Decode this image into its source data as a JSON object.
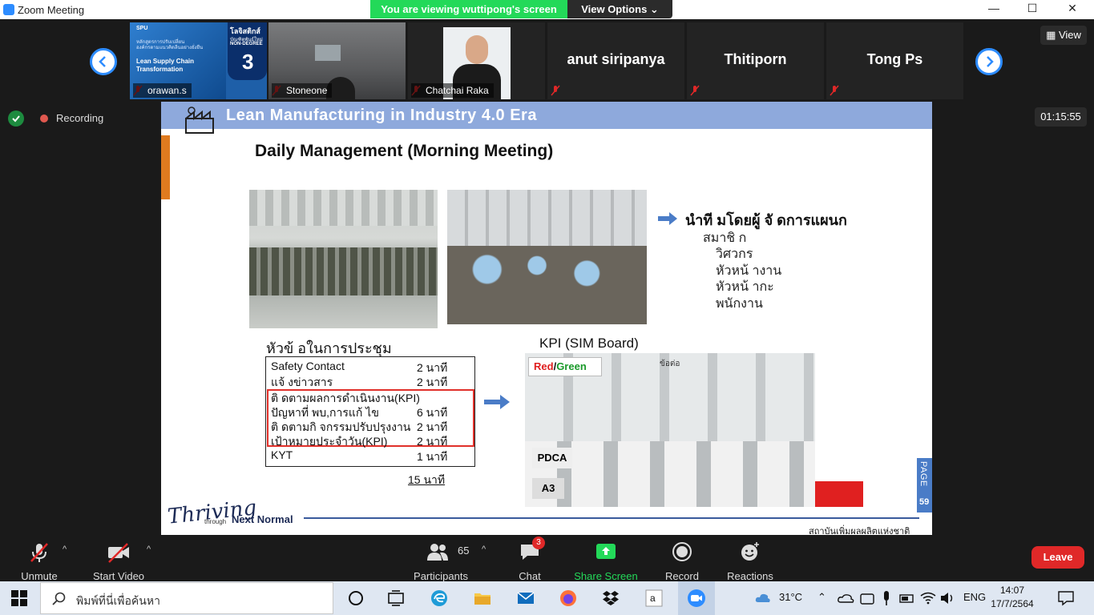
{
  "window": {
    "title": "Zoom Meeting",
    "minimize": "—",
    "maximize": "☐",
    "close": "✕"
  },
  "banner": {
    "viewing": "You are viewing wuttipong's screen",
    "view_options": "View Options ⌄"
  },
  "gallery": {
    "view_label": "View",
    "tiles": [
      {
        "name": "orawan.s",
        "muted": true,
        "video": true
      },
      {
        "name": "Stoneone",
        "muted": true,
        "video": true
      },
      {
        "name": "Chatchai Raka",
        "muted": true,
        "video": true
      },
      {
        "name": "anut siripanya",
        "muted": true,
        "video": false
      },
      {
        "name": "Thitiporn",
        "muted": true,
        "video": false
      },
      {
        "name": "Tong Ps",
        "muted": true,
        "video": false
      }
    ],
    "orawan_thumb": {
      "spu": "SPU",
      "line1": "หลักสูตรการปรับเปลี่ยน",
      "line2": "องค์กรตามแนวคิดลีนอย่างยั่งยืน",
      "course": "Lean Supply Chain Transformation",
      "badge_th": "โลจิสติกส์",
      "badge_sub": "บัณฑิตพันธุ์ใหม่",
      "non_degree": "NON-DEGREE",
      "num": "3"
    }
  },
  "status": {
    "recording": "Recording",
    "timer": "01:15:55"
  },
  "slide": {
    "header": "Lean Manufacturing in Industry 4.0 Era",
    "subtitle": "Daily Management (Morning Meeting)",
    "led_by": "นำที มโดยผู้ จั ดการแผนก",
    "members_label": "สมาชิ ก",
    "members": [
      "วิศวกร",
      "หัวหน้ างาน",
      "หัวหน้ ากะ",
      "พนักงาน"
    ],
    "agenda_title": "หัวข้ อในการประชุม",
    "agenda": [
      {
        "item": "Safety Contact",
        "dur": "2  นาที"
      },
      {
        "item": "แจ้ งข่าวสาร",
        "dur": "2 นาที"
      },
      {
        "item": "ติ ดตามผลการดำเนินงาน(KPI)",
        "dur": ""
      },
      {
        "item": "ปัญหาที่ พบ,การแก้ ไข",
        "dur": "6 นาที"
      },
      {
        "item": "ติ ดตามกิ จกรรมปรับปรุงงาน",
        "dur": "2 นาที"
      },
      {
        "item": "เป้าหมายประจำวัน(KPI)",
        "dur": "2 นาที"
      },
      {
        "item": "KYT",
        "dur": "1 นาที"
      }
    ],
    "total": "15 นาที",
    "kpi_title": "KPI (SIM Board)",
    "red": "Red",
    "slash": "/",
    "green": "Green",
    "board_label": "ข้อต่อ",
    "pdca": "PDCA",
    "a3": "A3",
    "page_label": "PAGE",
    "page_num": "59",
    "footer_thriving": "Thriving",
    "footer_through": "through",
    "footer_next": "Next Normal",
    "footer_institute": "สถาบันเพิ่มผลผลิตแห่งชาติ"
  },
  "controls": {
    "unmute": "Unmute",
    "start_video": "Start Video",
    "participants_count": "65",
    "participants": "Participants",
    "chat": "Chat",
    "chat_badge": "3",
    "share": "Share Screen",
    "record": "Record",
    "reactions": "Reactions",
    "leave": "Leave"
  },
  "taskbar": {
    "search_placeholder": "พิมพ์ที่นี่เพื่อค้นหา",
    "temp": "31°C",
    "lang": "ENG",
    "time": "14:07",
    "date": "17/7/2564"
  },
  "colors": {
    "zoom_blue": "#2d8cff",
    "banner_green": "#23d959",
    "leave_red": "#e02828",
    "slide_header": "#8ea9dc"
  }
}
